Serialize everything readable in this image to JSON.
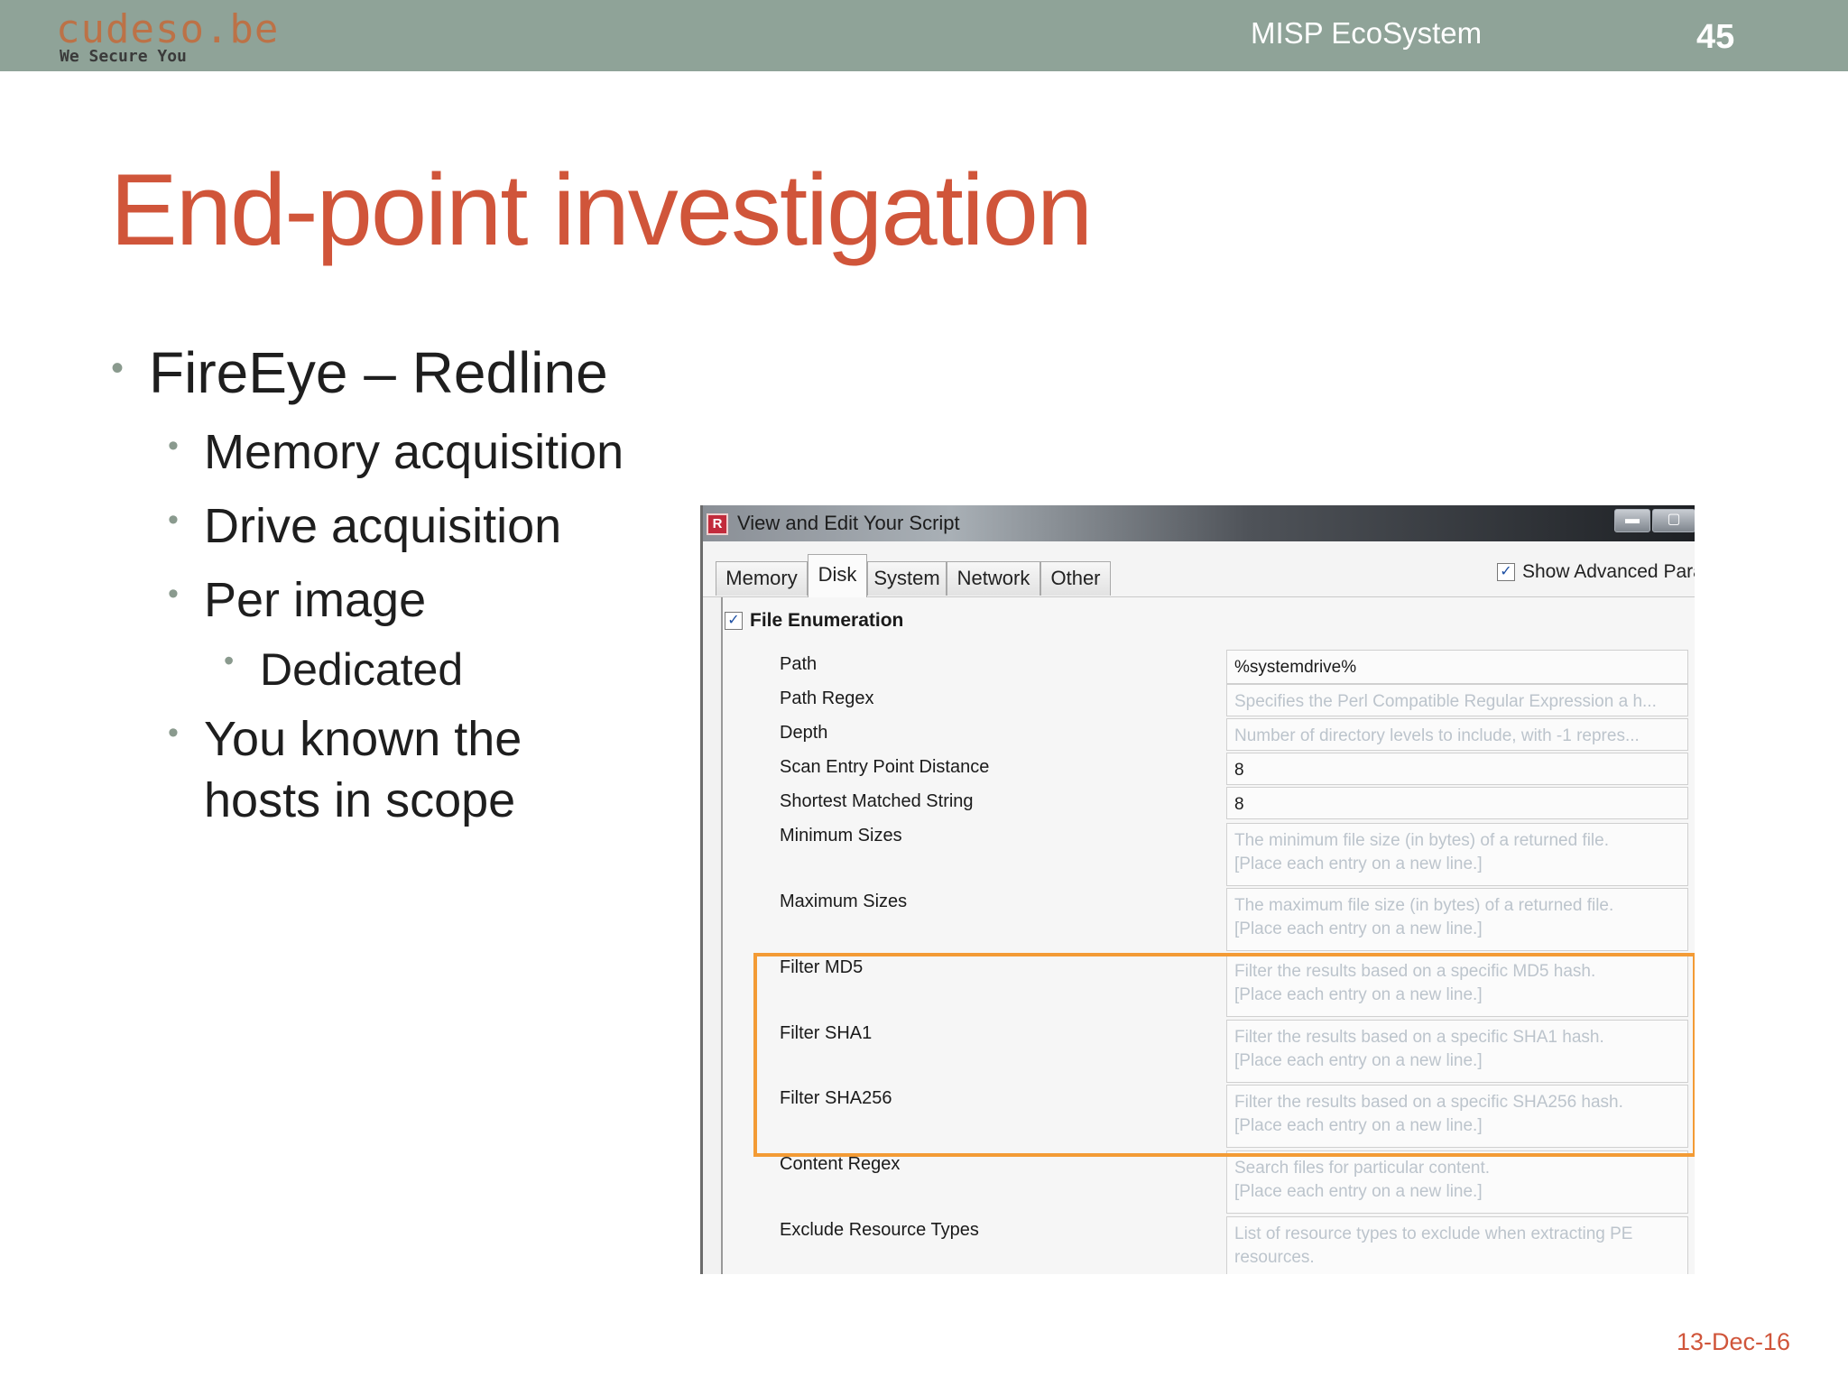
{
  "header": {
    "logo_text": "cudeso.be",
    "logo_tagline": "We Secure You",
    "deck_title": "MISP EcoSystem",
    "page_number": "45"
  },
  "slide": {
    "title": "End-point investigation",
    "bullets": [
      {
        "text": "FireEye – Redline"
      },
      {
        "text": "Memory acquisition"
      },
      {
        "text": "Drive acquisition"
      },
      {
        "text": "Per image"
      },
      {
        "text": "Dedicated"
      },
      {
        "text": "You known the"
      },
      {
        "text": "hosts in scope"
      }
    ],
    "date": "13-Dec-16"
  },
  "app": {
    "window_title": "View and Edit Your Script",
    "tabs": [
      "Memory",
      "Disk",
      "System",
      "Network",
      "Other"
    ],
    "active_tab": "Disk",
    "show_advanced_label": "Show Advanced Para",
    "show_advanced_checked": true,
    "section_label": "File Enumeration",
    "section_checked": true,
    "fields": [
      {
        "label": "Path",
        "value": "%systemdrive%"
      },
      {
        "label": "Path Regex",
        "value": "Specifies the Perl Compatible Regular Expression a h..."
      },
      {
        "label": "Depth",
        "value": "Number of directory levels to include, with -1 repres..."
      },
      {
        "label": "Scan Entry Point Distance",
        "value": "8"
      },
      {
        "label": "Shortest Matched String",
        "value": "8"
      },
      {
        "label": "Minimum Sizes",
        "value": "The minimum file size (in bytes) of a returned file.",
        "value2": "[Place each entry on a new line.]"
      },
      {
        "label": "Maximum Sizes",
        "value": "The maximum file size (in bytes) of a returned file.",
        "value2": "[Place each entry on a new line.]"
      },
      {
        "label": "Filter MD5",
        "value": "Filter the results based on a specific MD5 hash.",
        "value2": "[Place each entry on a new line.]"
      },
      {
        "label": "Filter SHA1",
        "value": "Filter the results based on a specific SHA1 hash.",
        "value2": "[Place each entry on a new line.]"
      },
      {
        "label": "Filter SHA256",
        "value": "Filter the results based on a specific SHA256 hash.",
        "value2": "[Place each entry on a new line.]"
      },
      {
        "label": "Content Regex",
        "value": "Search files for particular content.",
        "value2": "[Place each entry on a new line.]"
      },
      {
        "label": "Exclude Resource Types",
        "value": "List of resource types to exclude when extracting PE",
        "value2": "resources."
      }
    ]
  },
  "colors": {
    "header_bg": "#8fa398",
    "title_accent": "#d0553a",
    "highlight": "#f39b35"
  }
}
